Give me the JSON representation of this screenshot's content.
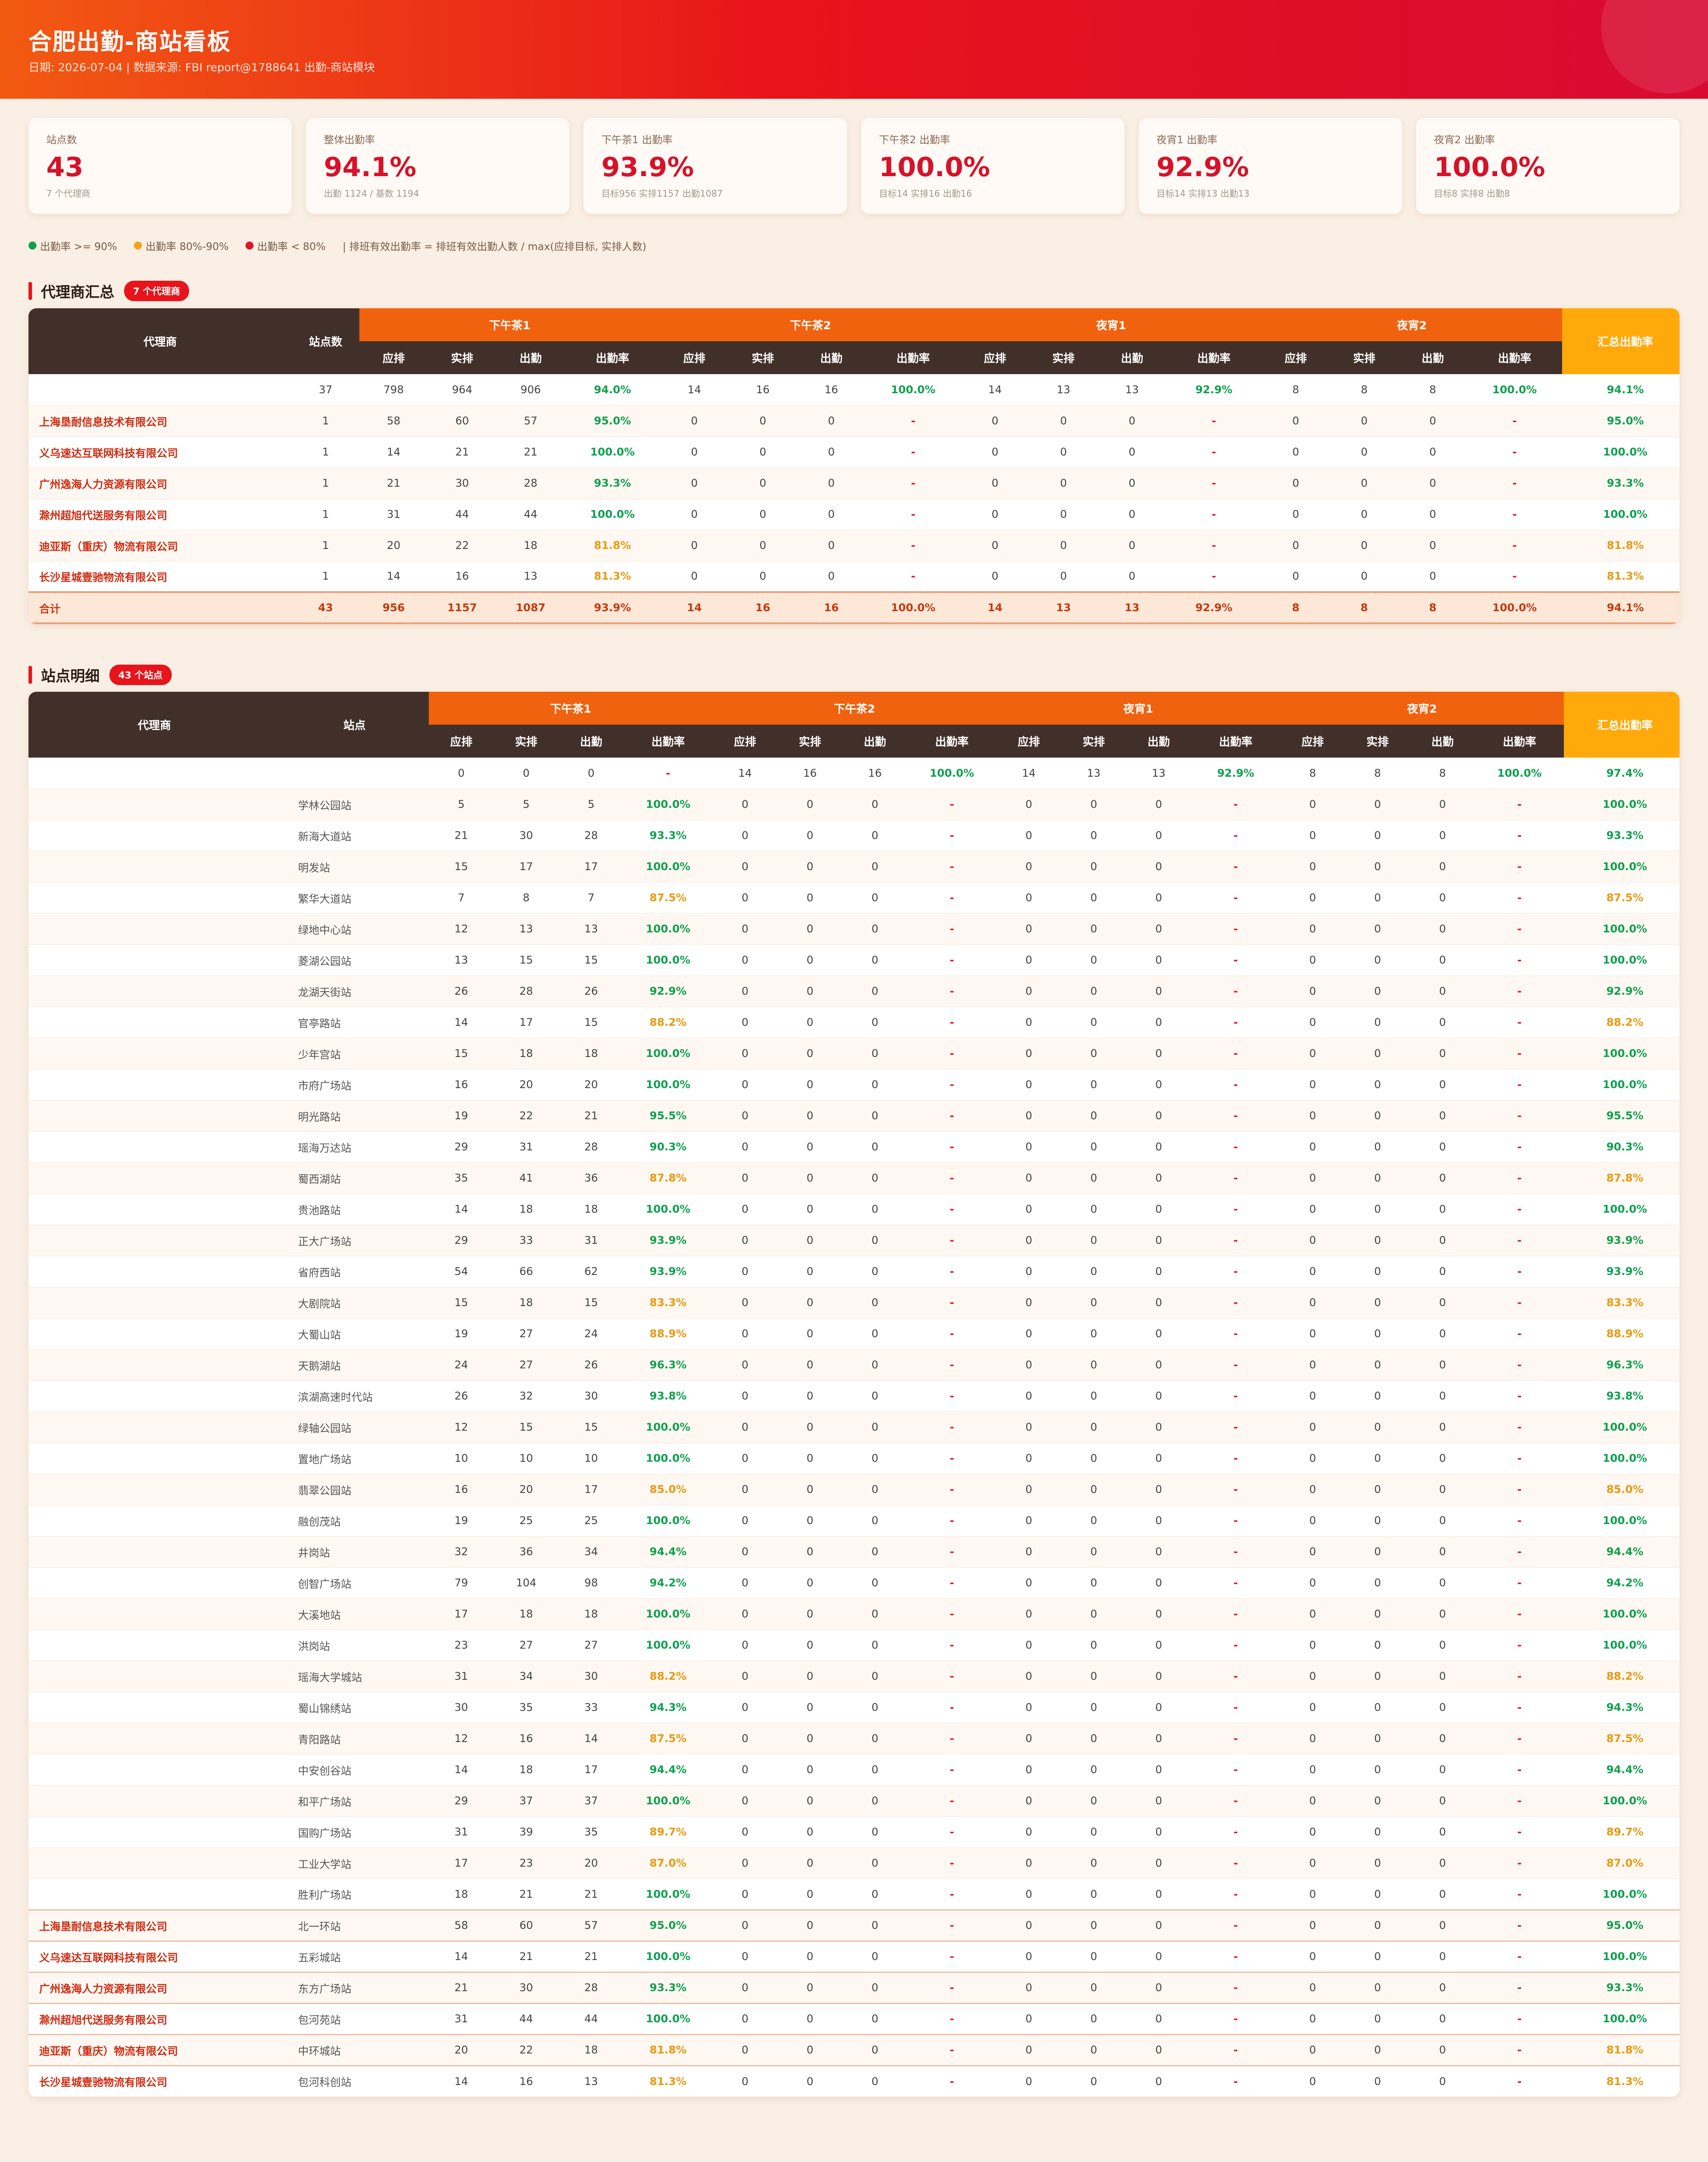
{
  "header": {
    "title": "合肥出勤-商站看板",
    "subtitle": "日期: 2026-07-04 | 数据来源: FBI report@1788641 出勤-商站模块"
  },
  "kpis": [
    {
      "label": "站点数",
      "value": "43",
      "note": "7 个代理商"
    },
    {
      "label": "整体出勤率",
      "value": "94.1%",
      "note": "出勤 1124 / 基数 1194"
    },
    {
      "label": "下午茶1 出勤率",
      "value": "93.9%",
      "note": "目标956 实排1157 出勤1087"
    },
    {
      "label": "下午茶2 出勤率",
      "value": "100.0%",
      "note": "目标14 实排16 出勤16"
    },
    {
      "label": "夜宵1 出勤率",
      "value": "92.9%",
      "note": "目标14 实排13 出勤13"
    },
    {
      "label": "夜宵2 出勤率",
      "value": "100.0%",
      "note": "目标8 实排8 出勤8"
    }
  ],
  "legend": {
    "green": "出勤率 >= 90%",
    "orange": "出勤率 80%-90%",
    "red": "出勤率 < 80%",
    "formula": "| 排班有效出勤率 = 排班有效出勤人数 / max(应排目标, 实排人数)"
  },
  "colors": {
    "green": "#10a050",
    "orange": "#e89a12",
    "red": "#e0142c"
  },
  "agent_section": {
    "title": "代理商汇总",
    "badge": "7 个代理商"
  },
  "station_section": {
    "title": "站点明细",
    "badge": "43 个站点"
  },
  "headers": {
    "agent": "代理商",
    "site_count": "站点数",
    "station": "站点",
    "groups": [
      "下午茶1",
      "下午茶2",
      "夜宵1",
      "夜宵2"
    ],
    "sub": [
      "应排",
      "实排",
      "出勤",
      "出勤率"
    ],
    "total_rate": "汇总出勤率"
  },
  "agent_rows": [
    {
      "agent": "",
      "count": "37",
      "cells": [
        "798",
        "964",
        "906",
        "94.0%",
        "14",
        "16",
        "16",
        "100.0%",
        "14",
        "13",
        "13",
        "92.9%",
        "8",
        "8",
        "8",
        "100.0%"
      ],
      "total": "94.1%"
    },
    {
      "agent": "上海垦耐信息技术有限公司",
      "count": "1",
      "cells": [
        "58",
        "60",
        "57",
        "95.0%",
        "0",
        "0",
        "0",
        "-",
        "0",
        "0",
        "0",
        "-",
        "0",
        "0",
        "0",
        "-"
      ],
      "total": "95.0%"
    },
    {
      "agent": "义乌速达互联网科技有限公司",
      "count": "1",
      "cells": [
        "14",
        "21",
        "21",
        "100.0%",
        "0",
        "0",
        "0",
        "-",
        "0",
        "0",
        "0",
        "-",
        "0",
        "0",
        "0",
        "-"
      ],
      "total": "100.0%"
    },
    {
      "agent": "广州逸海人力资源有限公司",
      "count": "1",
      "cells": [
        "21",
        "30",
        "28",
        "93.3%",
        "0",
        "0",
        "0",
        "-",
        "0",
        "0",
        "0",
        "-",
        "0",
        "0",
        "0",
        "-"
      ],
      "total": "93.3%"
    },
    {
      "agent": "滁州超旭代送服务有限公司",
      "count": "1",
      "cells": [
        "31",
        "44",
        "44",
        "100.0%",
        "0",
        "0",
        "0",
        "-",
        "0",
        "0",
        "0",
        "-",
        "0",
        "0",
        "0",
        "-"
      ],
      "total": "100.0%"
    },
    {
      "agent": "迪亚斯（重庆）物流有限公司",
      "count": "1",
      "cells": [
        "20",
        "22",
        "18",
        "81.8%",
        "0",
        "0",
        "0",
        "-",
        "0",
        "0",
        "0",
        "-",
        "0",
        "0",
        "0",
        "-"
      ],
      "total": "81.8%"
    },
    {
      "agent": "长沙星城壹驰物流有限公司",
      "count": "1",
      "cells": [
        "14",
        "16",
        "13",
        "81.3%",
        "0",
        "0",
        "0",
        "-",
        "0",
        "0",
        "0",
        "-",
        "0",
        "0",
        "0",
        "-"
      ],
      "total": "81.3%"
    }
  ],
  "agent_total": {
    "agent": "合计",
    "count": "43",
    "cells": [
      "956",
      "1157",
      "1087",
      "93.9%",
      "14",
      "16",
      "16",
      "100.0%",
      "14",
      "13",
      "13",
      "92.9%",
      "8",
      "8",
      "8",
      "100.0%"
    ],
    "total": "94.1%"
  },
  "station_rows": [
    {
      "agent": "",
      "station": "",
      "cells": [
        "0",
        "0",
        "0",
        "-",
        "14",
        "16",
        "16",
        "100.0%",
        "14",
        "13",
        "13",
        "92.9%",
        "8",
        "8",
        "8",
        "100.0%"
      ],
      "total": "97.4%"
    },
    {
      "agent": "",
      "station": "学林公园站",
      "cells": [
        "5",
        "5",
        "5",
        "100.0%",
        "0",
        "0",
        "0",
        "-",
        "0",
        "0",
        "0",
        "-",
        "0",
        "0",
        "0",
        "-"
      ],
      "total": "100.0%"
    },
    {
      "agent": "",
      "station": "新海大道站",
      "cells": [
        "21",
        "30",
        "28",
        "93.3%",
        "0",
        "0",
        "0",
        "-",
        "0",
        "0",
        "0",
        "-",
        "0",
        "0",
        "0",
        "-"
      ],
      "total": "93.3%"
    },
    {
      "agent": "",
      "station": "明发站",
      "cells": [
        "15",
        "17",
        "17",
        "100.0%",
        "0",
        "0",
        "0",
        "-",
        "0",
        "0",
        "0",
        "-",
        "0",
        "0",
        "0",
        "-"
      ],
      "total": "100.0%"
    },
    {
      "agent": "",
      "station": "繁华大道站",
      "cells": [
        "7",
        "8",
        "7",
        "87.5%",
        "0",
        "0",
        "0",
        "-",
        "0",
        "0",
        "0",
        "-",
        "0",
        "0",
        "0",
        "-"
      ],
      "total": "87.5%"
    },
    {
      "agent": "",
      "station": "绿地中心站",
      "cells": [
        "12",
        "13",
        "13",
        "100.0%",
        "0",
        "0",
        "0",
        "-",
        "0",
        "0",
        "0",
        "-",
        "0",
        "0",
        "0",
        "-"
      ],
      "total": "100.0%"
    },
    {
      "agent": "",
      "station": "菱湖公园站",
      "cells": [
        "13",
        "15",
        "15",
        "100.0%",
        "0",
        "0",
        "0",
        "-",
        "0",
        "0",
        "0",
        "-",
        "0",
        "0",
        "0",
        "-"
      ],
      "total": "100.0%"
    },
    {
      "agent": "",
      "station": "龙湖天街站",
      "cells": [
        "26",
        "28",
        "26",
        "92.9%",
        "0",
        "0",
        "0",
        "-",
        "0",
        "0",
        "0",
        "-",
        "0",
        "0",
        "0",
        "-"
      ],
      "total": "92.9%"
    },
    {
      "agent": "",
      "station": "官亭路站",
      "cells": [
        "14",
        "17",
        "15",
        "88.2%",
        "0",
        "0",
        "0",
        "-",
        "0",
        "0",
        "0",
        "-",
        "0",
        "0",
        "0",
        "-"
      ],
      "total": "88.2%"
    },
    {
      "agent": "",
      "station": "少年宫站",
      "cells": [
        "15",
        "18",
        "18",
        "100.0%",
        "0",
        "0",
        "0",
        "-",
        "0",
        "0",
        "0",
        "-",
        "0",
        "0",
        "0",
        "-"
      ],
      "total": "100.0%"
    },
    {
      "agent": "",
      "station": "市府广场站",
      "cells": [
        "16",
        "20",
        "20",
        "100.0%",
        "0",
        "0",
        "0",
        "-",
        "0",
        "0",
        "0",
        "-",
        "0",
        "0",
        "0",
        "-"
      ],
      "total": "100.0%"
    },
    {
      "agent": "",
      "station": "明光路站",
      "cells": [
        "19",
        "22",
        "21",
        "95.5%",
        "0",
        "0",
        "0",
        "-",
        "0",
        "0",
        "0",
        "-",
        "0",
        "0",
        "0",
        "-"
      ],
      "total": "95.5%"
    },
    {
      "agent": "",
      "station": "瑶海万达站",
      "cells": [
        "29",
        "31",
        "28",
        "90.3%",
        "0",
        "0",
        "0",
        "-",
        "0",
        "0",
        "0",
        "-",
        "0",
        "0",
        "0",
        "-"
      ],
      "total": "90.3%"
    },
    {
      "agent": "",
      "station": "蜀西湖站",
      "cells": [
        "35",
        "41",
        "36",
        "87.8%",
        "0",
        "0",
        "0",
        "-",
        "0",
        "0",
        "0",
        "-",
        "0",
        "0",
        "0",
        "-"
      ],
      "total": "87.8%"
    },
    {
      "agent": "",
      "station": "贵池路站",
      "cells": [
        "14",
        "18",
        "18",
        "100.0%",
        "0",
        "0",
        "0",
        "-",
        "0",
        "0",
        "0",
        "-",
        "0",
        "0",
        "0",
        "-"
      ],
      "total": "100.0%"
    },
    {
      "agent": "",
      "station": "正大广场站",
      "cells": [
        "29",
        "33",
        "31",
        "93.9%",
        "0",
        "0",
        "0",
        "-",
        "0",
        "0",
        "0",
        "-",
        "0",
        "0",
        "0",
        "-"
      ],
      "total": "93.9%"
    },
    {
      "agent": "",
      "station": "省府西站",
      "cells": [
        "54",
        "66",
        "62",
        "93.9%",
        "0",
        "0",
        "0",
        "-",
        "0",
        "0",
        "0",
        "-",
        "0",
        "0",
        "0",
        "-"
      ],
      "total": "93.9%"
    },
    {
      "agent": "",
      "station": "大剧院站",
      "cells": [
        "15",
        "18",
        "15",
        "83.3%",
        "0",
        "0",
        "0",
        "-",
        "0",
        "0",
        "0",
        "-",
        "0",
        "0",
        "0",
        "-"
      ],
      "total": "83.3%"
    },
    {
      "agent": "",
      "station": "大蜀山站",
      "cells": [
        "19",
        "27",
        "24",
        "88.9%",
        "0",
        "0",
        "0",
        "-",
        "0",
        "0",
        "0",
        "-",
        "0",
        "0",
        "0",
        "-"
      ],
      "total": "88.9%"
    },
    {
      "agent": "",
      "station": "天鹅湖站",
      "cells": [
        "24",
        "27",
        "26",
        "96.3%",
        "0",
        "0",
        "0",
        "-",
        "0",
        "0",
        "0",
        "-",
        "0",
        "0",
        "0",
        "-"
      ],
      "total": "96.3%"
    },
    {
      "agent": "",
      "station": "滨湖高速时代站",
      "cells": [
        "26",
        "32",
        "30",
        "93.8%",
        "0",
        "0",
        "0",
        "-",
        "0",
        "0",
        "0",
        "-",
        "0",
        "0",
        "0",
        "-"
      ],
      "total": "93.8%"
    },
    {
      "agent": "",
      "station": "绿轴公园站",
      "cells": [
        "12",
        "15",
        "15",
        "100.0%",
        "0",
        "0",
        "0",
        "-",
        "0",
        "0",
        "0",
        "-",
        "0",
        "0",
        "0",
        "-"
      ],
      "total": "100.0%"
    },
    {
      "agent": "",
      "station": "置地广场站",
      "cells": [
        "10",
        "10",
        "10",
        "100.0%",
        "0",
        "0",
        "0",
        "-",
        "0",
        "0",
        "0",
        "-",
        "0",
        "0",
        "0",
        "-"
      ],
      "total": "100.0%"
    },
    {
      "agent": "",
      "station": "翡翠公园站",
      "cells": [
        "16",
        "20",
        "17",
        "85.0%",
        "0",
        "0",
        "0",
        "-",
        "0",
        "0",
        "0",
        "-",
        "0",
        "0",
        "0",
        "-"
      ],
      "total": "85.0%"
    },
    {
      "agent": "",
      "station": "融创茂站",
      "cells": [
        "19",
        "25",
        "25",
        "100.0%",
        "0",
        "0",
        "0",
        "-",
        "0",
        "0",
        "0",
        "-",
        "0",
        "0",
        "0",
        "-"
      ],
      "total": "100.0%"
    },
    {
      "agent": "",
      "station": "井岗站",
      "cells": [
        "32",
        "36",
        "34",
        "94.4%",
        "0",
        "0",
        "0",
        "-",
        "0",
        "0",
        "0",
        "-",
        "0",
        "0",
        "0",
        "-"
      ],
      "total": "94.4%"
    },
    {
      "agent": "",
      "station": "创智广场站",
      "cells": [
        "79",
        "104",
        "98",
        "94.2%",
        "0",
        "0",
        "0",
        "-",
        "0",
        "0",
        "0",
        "-",
        "0",
        "0",
        "0",
        "-"
      ],
      "total": "94.2%"
    },
    {
      "agent": "",
      "station": "大溪地站",
      "cells": [
        "17",
        "18",
        "18",
        "100.0%",
        "0",
        "0",
        "0",
        "-",
        "0",
        "0",
        "0",
        "-",
        "0",
        "0",
        "0",
        "-"
      ],
      "total": "100.0%"
    },
    {
      "agent": "",
      "station": "洪岗站",
      "cells": [
        "23",
        "27",
        "27",
        "100.0%",
        "0",
        "0",
        "0",
        "-",
        "0",
        "0",
        "0",
        "-",
        "0",
        "0",
        "0",
        "-"
      ],
      "total": "100.0%"
    },
    {
      "agent": "",
      "station": "瑶海大学城站",
      "cells": [
        "31",
        "34",
        "30",
        "88.2%",
        "0",
        "0",
        "0",
        "-",
        "0",
        "0",
        "0",
        "-",
        "0",
        "0",
        "0",
        "-"
      ],
      "total": "88.2%"
    },
    {
      "agent": "",
      "station": "蜀山锦绣站",
      "cells": [
        "30",
        "35",
        "33",
        "94.3%",
        "0",
        "0",
        "0",
        "-",
        "0",
        "0",
        "0",
        "-",
        "0",
        "0",
        "0",
        "-"
      ],
      "total": "94.3%"
    },
    {
      "agent": "",
      "station": "青阳路站",
      "cells": [
        "12",
        "16",
        "14",
        "87.5%",
        "0",
        "0",
        "0",
        "-",
        "0",
        "0",
        "0",
        "-",
        "0",
        "0",
        "0",
        "-"
      ],
      "total": "87.5%"
    },
    {
      "agent": "",
      "station": "中安创谷站",
      "cells": [
        "14",
        "18",
        "17",
        "94.4%",
        "0",
        "0",
        "0",
        "-",
        "0",
        "0",
        "0",
        "-",
        "0",
        "0",
        "0",
        "-"
      ],
      "total": "94.4%"
    },
    {
      "agent": "",
      "station": "和平广场站",
      "cells": [
        "29",
        "37",
        "37",
        "100.0%",
        "0",
        "0",
        "0",
        "-",
        "0",
        "0",
        "0",
        "-",
        "0",
        "0",
        "0",
        "-"
      ],
      "total": "100.0%"
    },
    {
      "agent": "",
      "station": "国购广场站",
      "cells": [
        "31",
        "39",
        "35",
        "89.7%",
        "0",
        "0",
        "0",
        "-",
        "0",
        "0",
        "0",
        "-",
        "0",
        "0",
        "0",
        "-"
      ],
      "total": "89.7%"
    },
    {
      "agent": "",
      "station": "工业大学站",
      "cells": [
        "17",
        "23",
        "20",
        "87.0%",
        "0",
        "0",
        "0",
        "-",
        "0",
        "0",
        "0",
        "-",
        "0",
        "0",
        "0",
        "-"
      ],
      "total": "87.0%"
    },
    {
      "agent": "",
      "station": "胜利广场站",
      "cells": [
        "18",
        "21",
        "21",
        "100.0%",
        "0",
        "0",
        "0",
        "-",
        "0",
        "0",
        "0",
        "-",
        "0",
        "0",
        "0",
        "-"
      ],
      "total": "100.0%"
    },
    {
      "agent": "上海垦耐信息技术有限公司",
      "station": "北一环站",
      "cells": [
        "58",
        "60",
        "57",
        "95.0%",
        "0",
        "0",
        "0",
        "-",
        "0",
        "0",
        "0",
        "-",
        "0",
        "0",
        "0",
        "-"
      ],
      "total": "95.0%"
    },
    {
      "agent": "义乌速达互联网科技有限公司",
      "station": "五彩城站",
      "cells": [
        "14",
        "21",
        "21",
        "100.0%",
        "0",
        "0",
        "0",
        "-",
        "0",
        "0",
        "0",
        "-",
        "0",
        "0",
        "0",
        "-"
      ],
      "total": "100.0%"
    },
    {
      "agent": "广州逸海人力资源有限公司",
      "station": "东方广场站",
      "cells": [
        "21",
        "30",
        "28",
        "93.3%",
        "0",
        "0",
        "0",
        "-",
        "0",
        "0",
        "0",
        "-",
        "0",
        "0",
        "0",
        "-"
      ],
      "total": "93.3%"
    },
    {
      "agent": "滁州超旭代送服务有限公司",
      "station": "包河苑站",
      "cells": [
        "31",
        "44",
        "44",
        "100.0%",
        "0",
        "0",
        "0",
        "-",
        "0",
        "0",
        "0",
        "-",
        "0",
        "0",
        "0",
        "-"
      ],
      "total": "100.0%"
    },
    {
      "agent": "迪亚斯（重庆）物流有限公司",
      "station": "中环城站",
      "cells": [
        "20",
        "22",
        "18",
        "81.8%",
        "0",
        "0",
        "0",
        "-",
        "0",
        "0",
        "0",
        "-",
        "0",
        "0",
        "0",
        "-"
      ],
      "total": "81.8%"
    },
    {
      "agent": "长沙星城壹驰物流有限公司",
      "station": "包河科创站",
      "cells": [
        "14",
        "16",
        "13",
        "81.3%",
        "0",
        "0",
        "0",
        "-",
        "0",
        "0",
        "0",
        "-",
        "0",
        "0",
        "0",
        "-"
      ],
      "total": "81.3%"
    }
  ]
}
